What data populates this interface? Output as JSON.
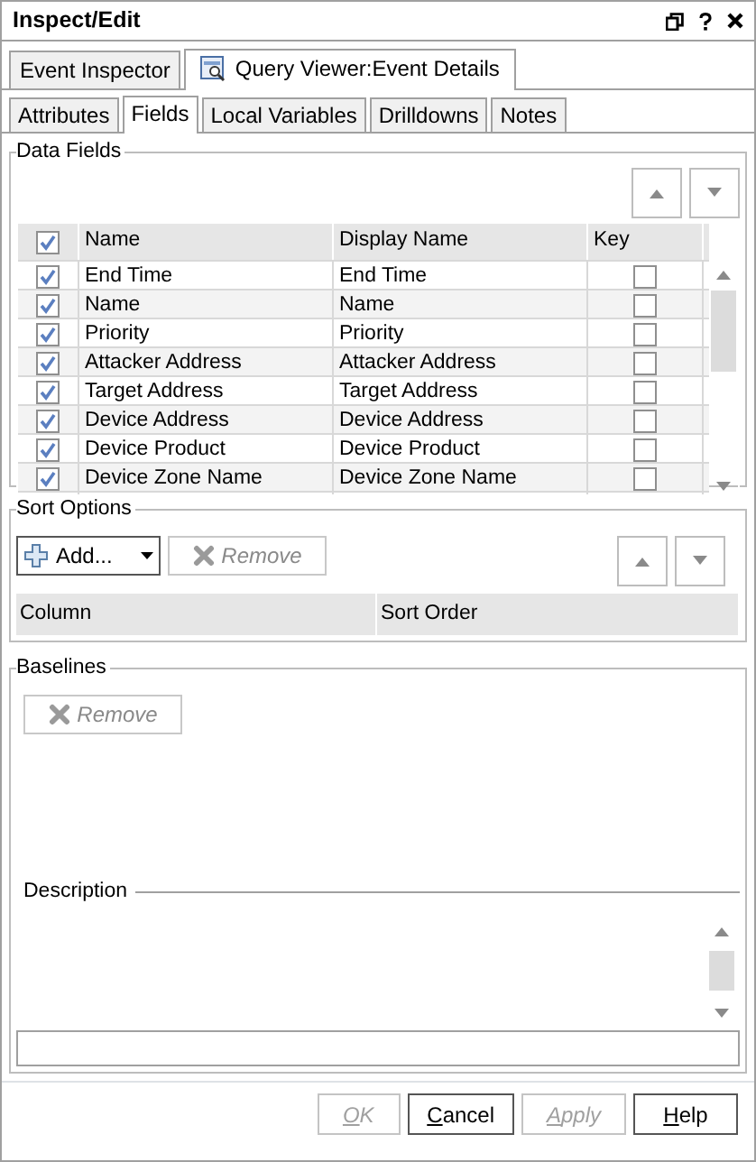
{
  "window": {
    "title": "Inspect/Edit"
  },
  "outer_tabs": [
    {
      "label": "Event Inspector",
      "selected": false
    },
    {
      "label": "Query Viewer:Event Details",
      "selected": true
    }
  ],
  "inner_tabs": [
    {
      "label": "Attributes",
      "selected": false
    },
    {
      "label": "Fields",
      "selected": true
    },
    {
      "label": "Local Variables",
      "selected": false
    },
    {
      "label": "Drilldowns",
      "selected": false
    },
    {
      "label": "Notes",
      "selected": false
    }
  ],
  "data_fields": {
    "title": "Data Fields",
    "all_checked": true,
    "columns": [
      "Name",
      "Display Name",
      "Key"
    ],
    "rows": [
      {
        "checked": true,
        "name": "End Time",
        "display_name": "End Time",
        "key": false
      },
      {
        "checked": true,
        "name": "Name",
        "display_name": "Name",
        "key": false
      },
      {
        "checked": true,
        "name": "Priority",
        "display_name": "Priority",
        "key": false
      },
      {
        "checked": true,
        "name": "Attacker Address",
        "display_name": "Attacker Address",
        "key": false
      },
      {
        "checked": true,
        "name": "Target Address",
        "display_name": "Target Address",
        "key": false
      },
      {
        "checked": true,
        "name": "Device Address",
        "display_name": "Device Address",
        "key": false
      },
      {
        "checked": true,
        "name": "Device Product",
        "display_name": "Device Product",
        "key": false
      },
      {
        "checked": true,
        "name": "Device Zone Name",
        "display_name": "Device Zone Name",
        "key": false
      }
    ]
  },
  "sort_options": {
    "title": "Sort Options",
    "add_button": "Add...",
    "remove_button": {
      "label": "Remove",
      "disabled": true
    },
    "columns": [
      "Column",
      "Sort Order"
    ]
  },
  "baselines": {
    "title": "Baselines",
    "remove_button": {
      "label": "Remove",
      "disabled": true
    },
    "description_label": "Description"
  },
  "buttons": [
    {
      "label": "OK",
      "disabled": true
    },
    {
      "label": "Cancel",
      "disabled": false
    },
    {
      "label": "Apply",
      "disabled": true
    },
    {
      "label": "Help",
      "disabled": false
    }
  ]
}
